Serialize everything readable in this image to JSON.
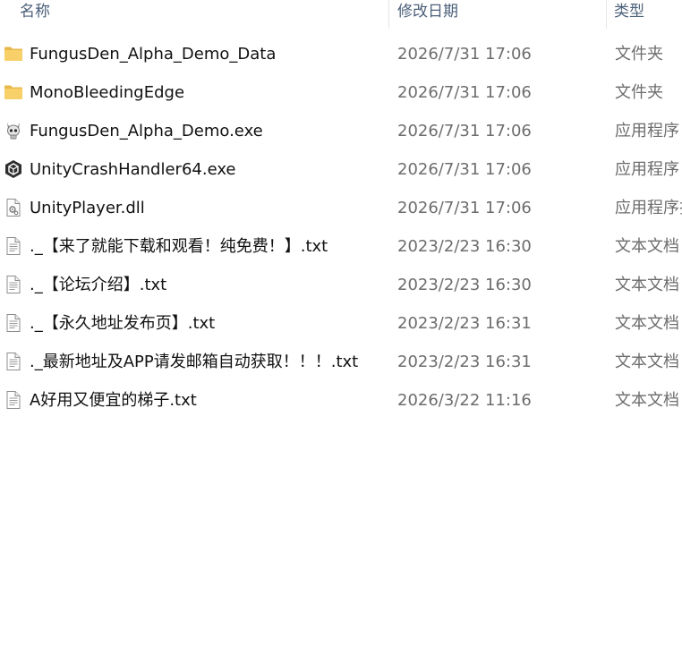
{
  "columns": {
    "name": "名称",
    "date": "修改日期",
    "type": "类型"
  },
  "files": [
    {
      "icon": "folder-icon",
      "name": "FungusDen_Alpha_Demo_Data",
      "date": "2026/7/31 17:06",
      "type": "文件夹"
    },
    {
      "icon": "folder-icon",
      "name": "MonoBleedingEdge",
      "date": "2026/7/31 17:06",
      "type": "文件夹"
    },
    {
      "icon": "skull-app-icon",
      "name": "FungusDen_Alpha_Demo.exe",
      "date": "2026/7/31 17:06",
      "type": "应用程序"
    },
    {
      "icon": "unity-app-icon",
      "name": "UnityCrashHandler64.exe",
      "date": "2026/7/31 17:06",
      "type": "应用程序"
    },
    {
      "icon": "dll-file-icon",
      "name": "UnityPlayer.dll",
      "date": "2026/7/31 17:06",
      "type": "应用程序扩"
    },
    {
      "icon": "text-file-icon",
      "name": "._【来了就能下载和观看！纯免费！】.txt",
      "date": "2023/2/23 16:30",
      "type": "文本文档"
    },
    {
      "icon": "text-file-icon",
      "name": "._【论坛介绍】.txt",
      "date": "2023/2/23 16:30",
      "type": "文本文档"
    },
    {
      "icon": "text-file-icon",
      "name": "._【永久地址发布页】.txt",
      "date": "2023/2/23 16:31",
      "type": "文本文档"
    },
    {
      "icon": "text-file-icon",
      "name": "._最新地址及APP请发邮箱自动获取！！！.txt",
      "date": "2023/2/23 16:31",
      "type": "文本文档"
    },
    {
      "icon": "text-file-icon",
      "name": "A好用又便宜的梯子.txt",
      "date": "2026/3/22 11:16",
      "type": "文本文档"
    }
  ]
}
